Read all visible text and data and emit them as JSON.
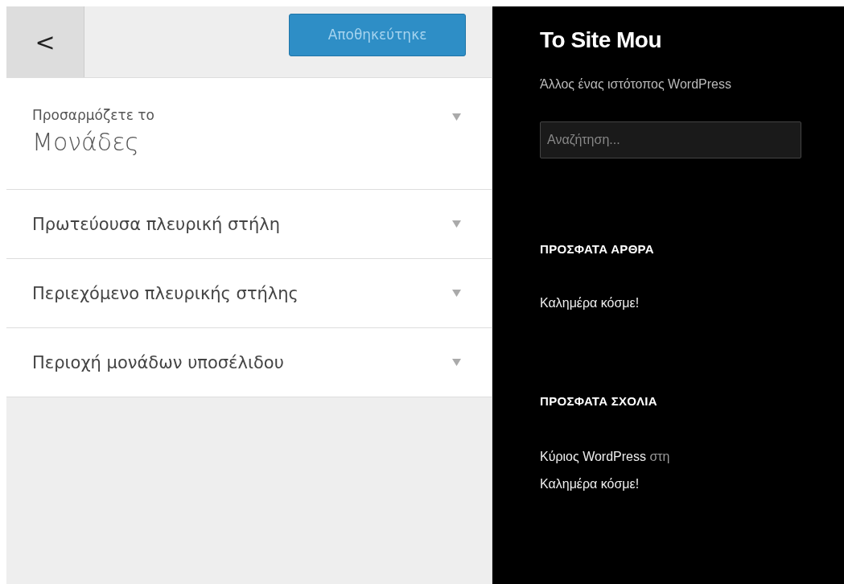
{
  "customizer": {
    "back_button": "<",
    "save_button": "Αποθηκεύτηκε",
    "context": {
      "prefix": "Προσαρμόζετε το",
      "title": "Μονάδες"
    },
    "sections": [
      {
        "label": "Πρωτεύουσα πλευρική στήλη"
      },
      {
        "label": "Περιεχόμενο πλευρικής στήλης"
      },
      {
        "label": "Περιοχή μονάδων υποσέλιδου"
      }
    ]
  },
  "preview": {
    "site_title": "To Site Mou",
    "tagline": "Άλλος ένας ιστότοπος WordPress",
    "search": {
      "placeholder": "Αναζήτηση..."
    },
    "widgets": [
      {
        "kind": "posts",
        "heading": "ΠΡΟΣΦΑΤΑ ΑΡΘΡΑ",
        "items": [
          "Καλημέρα κόσμε!"
        ]
      },
      {
        "kind": "comments",
        "heading": "ΠΡΟΣΦΑΤΑ ΣΧΟΛΙΑ",
        "comments": [
          {
            "author": "Κύριος WordPress",
            "connector": "στη",
            "post": "Καλημέρα κόσμε!"
          }
        ]
      }
    ]
  }
}
